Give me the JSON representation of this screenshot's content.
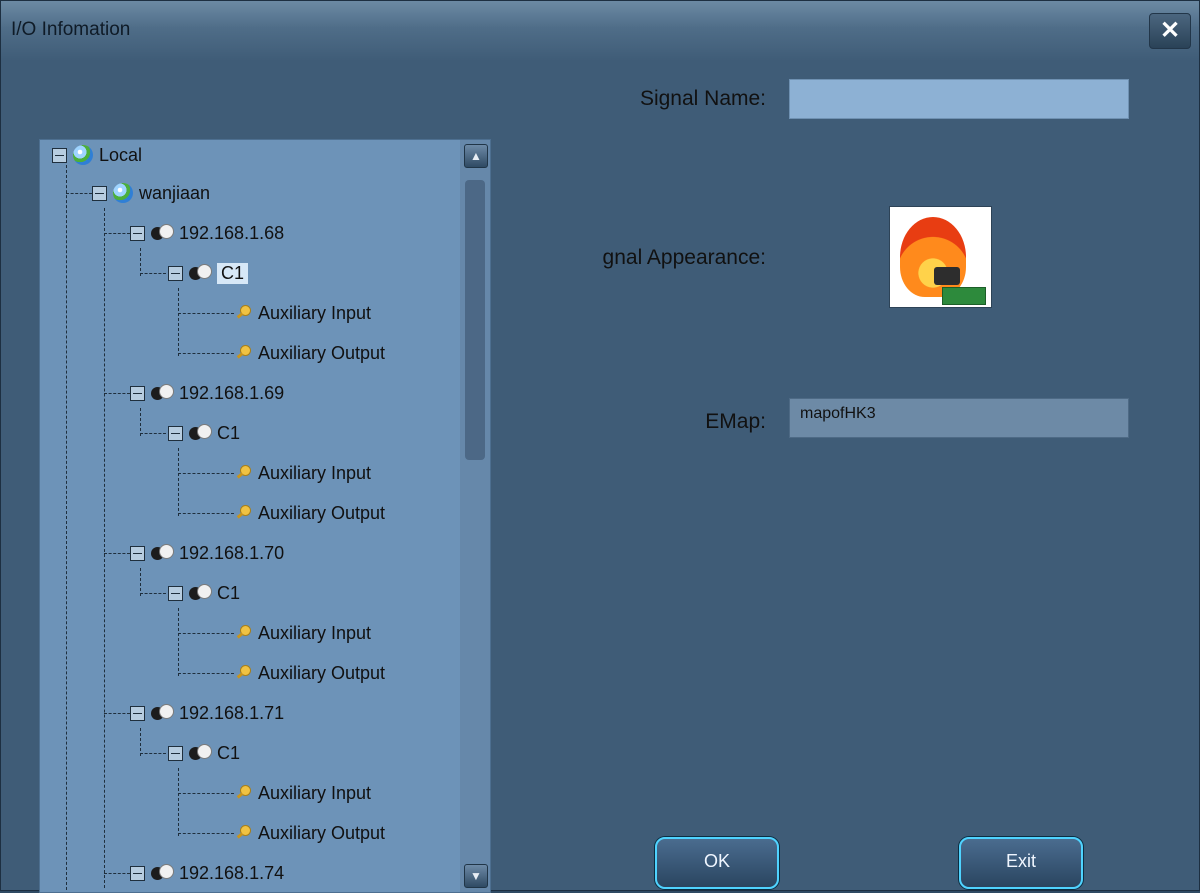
{
  "window": {
    "title": "I/O Infomation"
  },
  "form": {
    "signal_name_label": "Signal Name:",
    "signal_name_value": "",
    "appearance_label": "gnal Appearance:",
    "emap_label": "EMap:",
    "emap_value": "mapofHK3"
  },
  "buttons": {
    "ok": "OK",
    "exit": "Exit"
  },
  "tree": {
    "root": "Local",
    "site": "wanjiaan",
    "devices": [
      {
        "ip": "192.168.1.68",
        "channel": "C1",
        "inputs": "Auxiliary Input",
        "outputs": "Auxiliary Output"
      },
      {
        "ip": "192.168.1.69",
        "channel": "C1",
        "inputs": "Auxiliary Input",
        "outputs": "Auxiliary Output"
      },
      {
        "ip": "192.168.1.70",
        "channel": "C1",
        "inputs": "Auxiliary Input",
        "outputs": "Auxiliary Output"
      },
      {
        "ip": "192.168.1.71",
        "channel": "C1",
        "inputs": "Auxiliary Input",
        "outputs": "Auxiliary Output"
      },
      {
        "ip": "192.168.1.74"
      }
    ]
  },
  "icons": {
    "close": "close-icon",
    "tree_toggle": "collapse-icon",
    "root": "globe-icon",
    "site": "globe-icon",
    "device": "camera-icon",
    "io": "key-icon",
    "appearance": "fire-alarm-icon"
  }
}
